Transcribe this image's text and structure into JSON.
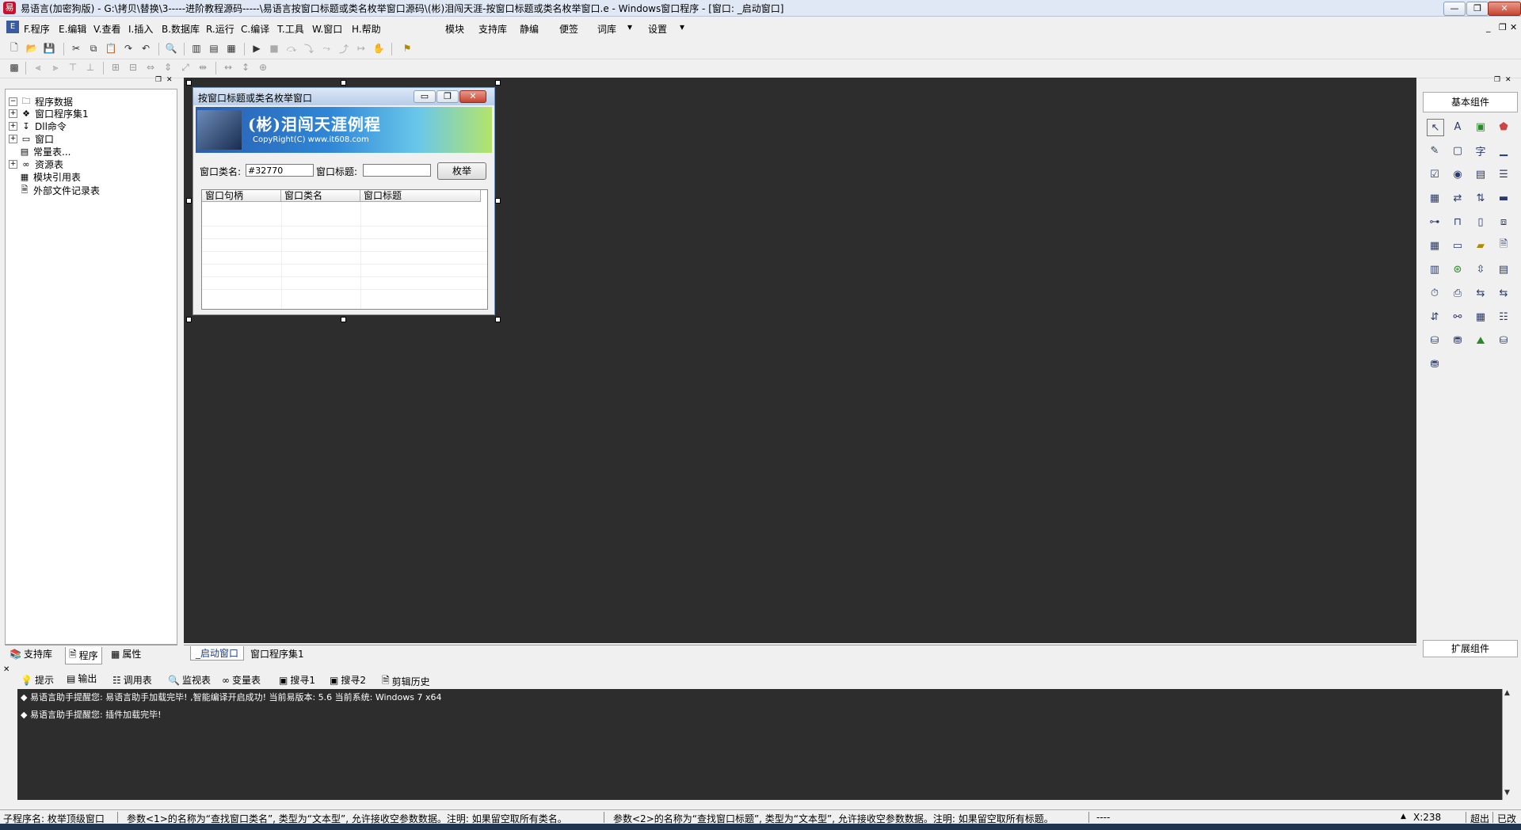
{
  "window": {
    "title": "易语言(加密狗版) - G:\\拷贝\\替换\\3-----进阶教程源码-----\\易语言按窗口标题或类名枚举窗口源码\\(彬)泪闯天涯-按窗口标题或类名枚举窗口.e - Windows窗口程序 - [窗口: _启动窗口]",
    "min": "—",
    "max": "❐",
    "close": "✕"
  },
  "menu": {
    "items": [
      {
        "key": "F",
        "label": "F.程序"
      },
      {
        "key": "E",
        "label": "E.编辑"
      },
      {
        "key": "V",
        "label": "V.查看"
      },
      {
        "key": "I",
        "label": "I.插入"
      },
      {
        "key": "B",
        "label": "B.数据库"
      },
      {
        "key": "R",
        "label": "R.运行"
      },
      {
        "key": "C",
        "label": "C.编译"
      },
      {
        "key": "T",
        "label": "T.工具"
      },
      {
        "key": "W",
        "label": "W.窗口"
      },
      {
        "key": "H",
        "label": "H.帮助"
      }
    ],
    "extra": [
      "模块",
      "支持库",
      "静编",
      "便签",
      "词库",
      "设置"
    ]
  },
  "left_panel": {
    "tree": [
      {
        "label": "程序数据",
        "icon": "folder-icon",
        "indent": 0,
        "expand": "-"
      },
      {
        "label": "窗口程序集1",
        "icon": "module-icon",
        "indent": 1,
        "expand": "+"
      },
      {
        "label": "Dll命令",
        "icon": "dll-icon",
        "indent": 1,
        "expand": "+"
      },
      {
        "label": "窗口",
        "icon": "window-icon",
        "indent": 1,
        "expand": "+"
      },
      {
        "label": "常量表...",
        "icon": "constant-icon",
        "indent": 1,
        "expand": ""
      },
      {
        "label": "资源表",
        "icon": "resource-icon",
        "indent": 1,
        "expand": "+"
      },
      {
        "label": "模块引用表",
        "icon": "module-ref-icon",
        "indent": 1,
        "expand": ""
      },
      {
        "label": "外部文件记录表",
        "icon": "file-record-icon",
        "indent": 1,
        "expand": ""
      }
    ],
    "tabs": [
      "支持库",
      "程序",
      "属性"
    ]
  },
  "form": {
    "title": "按窗口标题或类名枚举窗口",
    "banner_title": "(彬)泪闯天涯例程",
    "banner_sub": "CopyRight(C) www.it608.com",
    "label_class": "窗口类名:",
    "class_value": "#32770",
    "label_title": "窗口标题:",
    "title_value": "",
    "enum_button": "枚举",
    "columns": [
      "窗口句柄",
      "窗口类名",
      "窗口标题"
    ]
  },
  "designer_tabs": [
    "_启动窗口",
    "窗口程序集1"
  ],
  "right_panel": {
    "header": "基本组件",
    "footer": "扩展组件"
  },
  "output_tabs": [
    "提示",
    "输出",
    "调用表",
    "监视表",
    "变量表",
    "搜寻1",
    "搜寻2",
    "剪辑历史"
  ],
  "output_lines": [
    "易语言助手提醒您: 易语言助手加载完毕! ,智能编译开启成功! 当前易版本: 5.6 当前系统: Windows 7 x64",
    "易语言助手提醒您: 插件加载完毕!"
  ],
  "status": {
    "sub": "子程序名: 枚举顶级窗口",
    "param1": "参数<1>的名称为“查找窗口类名”, 类型为“文本型”, 允许接收空参数数据。注明: 如果留空取所有类名。",
    "param2": "参数<2>的名称为“查找窗口标题”, 类型为“文本型”, 允许接收空参数数据。注明: 如果留空取所有标题。",
    "dash": "----",
    "x": "X:238",
    "overwrite": "超出",
    "saved": "已改"
  }
}
